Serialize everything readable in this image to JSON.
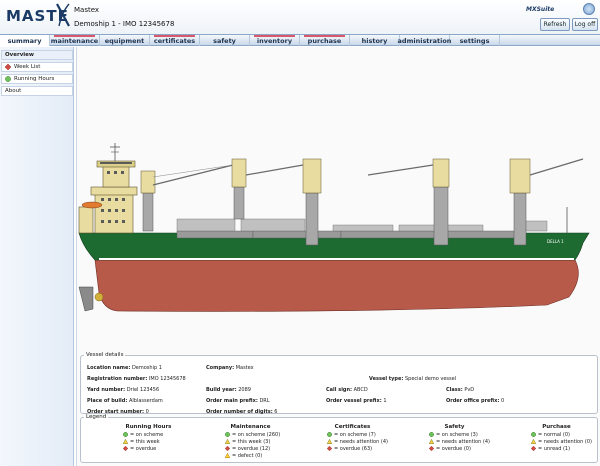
{
  "header": {
    "logo": "MASTE",
    "app_name": "Mastex",
    "vessel": "Demoship 1 - IMO 12345678",
    "suite": "MXSuite",
    "refresh": "Refresh",
    "logoff": "Log off"
  },
  "nav": {
    "tabs": [
      {
        "label": "summary",
        "active": true,
        "flag": false
      },
      {
        "label": "maintenance",
        "active": false,
        "flag": true
      },
      {
        "label": "equipment",
        "active": false,
        "flag": false
      },
      {
        "label": "certificates",
        "active": false,
        "flag": true
      },
      {
        "label": "safety",
        "active": false,
        "flag": false
      },
      {
        "label": "inventory",
        "active": false,
        "flag": true
      },
      {
        "label": "purchase",
        "active": false,
        "flag": true
      },
      {
        "label": "history",
        "active": false,
        "flag": false
      },
      {
        "label": "administration",
        "active": false,
        "flag": false
      },
      {
        "label": "settings",
        "active": false,
        "flag": false
      }
    ]
  },
  "sidebar": {
    "overview": "Overview",
    "week_list": "Week List",
    "running_hours": "Running Hours",
    "about": "About"
  },
  "ship": {
    "name_on_hull": "DELLA 1"
  },
  "vessel_details": {
    "title": "Vessel details",
    "location_name_label": "Location name:",
    "location_name": "Demoship 1",
    "company_label": "Company:",
    "company": "Mastex",
    "registration_label": "Registration number:",
    "registration": "IMO 12345678",
    "vessel_type_label": "Vessel type:",
    "vessel_type": "Special demo vessel",
    "yard_label": "Yard number:",
    "yard": "Driel 123456",
    "build_year_label": "Build year:",
    "build_year": "2089",
    "call_sign_label": "Call sign:",
    "call_sign": "ABCD",
    "class_label": "Class:",
    "class": "PvD",
    "place_label": "Place of build:",
    "place": "Alblasserdam",
    "order_main_label": "Order main prefix:",
    "order_main": "DRL",
    "order_vessel_label": "Order vessel prefix:",
    "order_vessel": "1",
    "order_office_label": "Order office prefix:",
    "order_office": "0",
    "order_start_label": "Order start number:",
    "order_start": "0",
    "order_digits_label": "Order number of digits:",
    "order_digits": "6"
  },
  "legend": {
    "title": "Legend",
    "columns": [
      {
        "title": "Running Hours",
        "rows": [
          {
            "icon": "green",
            "text": "= on scheme"
          },
          {
            "icon": "yellow",
            "text": "= this week"
          },
          {
            "icon": "red",
            "text": "= overdue"
          }
        ]
      },
      {
        "title": "Maintenance",
        "rows": [
          {
            "icon": "green",
            "text": "= on scheme (260)"
          },
          {
            "icon": "yellow",
            "text": "= this week (3)"
          },
          {
            "icon": "red",
            "text": "= overdue (12)"
          },
          {
            "icon": "defect",
            "text": "= defect (0)"
          }
        ]
      },
      {
        "title": "Certificates",
        "rows": [
          {
            "icon": "green",
            "text": "= on scheme (7)"
          },
          {
            "icon": "yellow",
            "text": "= needs attention (4)"
          },
          {
            "icon": "red",
            "text": "= overdue (63)"
          }
        ]
      },
      {
        "title": "Safety",
        "rows": [
          {
            "icon": "green",
            "text": "= on scheme (3)"
          },
          {
            "icon": "yellow",
            "text": "= needs attention (4)"
          },
          {
            "icon": "red",
            "text": "= overdue (0)"
          }
        ]
      },
      {
        "title": "Purchase",
        "rows": [
          {
            "icon": "green",
            "text": "= normal (0)"
          },
          {
            "icon": "yellow",
            "text": "= needs attention (0)"
          },
          {
            "icon": "red",
            "text": "= unread (1)"
          }
        ]
      }
    ]
  },
  "colors": {
    "hull_red": "#b85a4a",
    "hull_green": "#1e6b32",
    "superstructure": "#e8dca0",
    "crane": "#a8a8a8",
    "nav_flag": "#d9576a"
  }
}
